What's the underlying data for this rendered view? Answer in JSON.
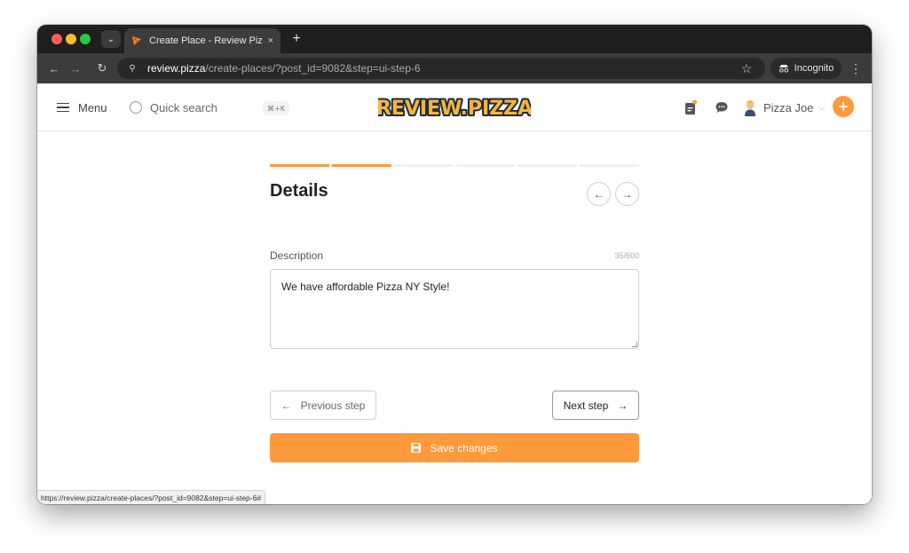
{
  "browser": {
    "tab_title": "Create Place - Review Pizza",
    "tab_close": "×",
    "new_tab": "+",
    "url_host": "review.pizza",
    "url_path": "/create-places/?post_id=9082&step=ui-step-6",
    "incognito_label": "Incognito",
    "status_url": "https://review.pizza/create-places/?post_id=9082&step=ui-step-6#"
  },
  "header": {
    "menu_label": "Menu",
    "search_label": "Quick search",
    "shortcut": "⌘+K",
    "logo_text": "REVIEW.PIZZA",
    "user_name": "Pizza Joe",
    "add_label": "+"
  },
  "form": {
    "progress": {
      "total_steps": 6,
      "completed_steps": 2
    },
    "title": "Details",
    "description_label": "Description",
    "char_count": "35/600",
    "description_value": "We have affordable Pizza NY Style!",
    "prev_label": "Previous step",
    "next_label": "Next step",
    "save_label": "Save changes"
  },
  "colors": {
    "accent": "#ff9a3c",
    "tabstrip": "#1f1f1f",
    "toolbar": "#3c3c3c"
  },
  "icons": [
    "search-icon",
    "shield-icon",
    "star-icon",
    "incognito-icon",
    "menu-icon",
    "notification-icon",
    "chat-icon",
    "avatar",
    "arrow-left-icon",
    "arrow-right-icon",
    "save-icon"
  ]
}
